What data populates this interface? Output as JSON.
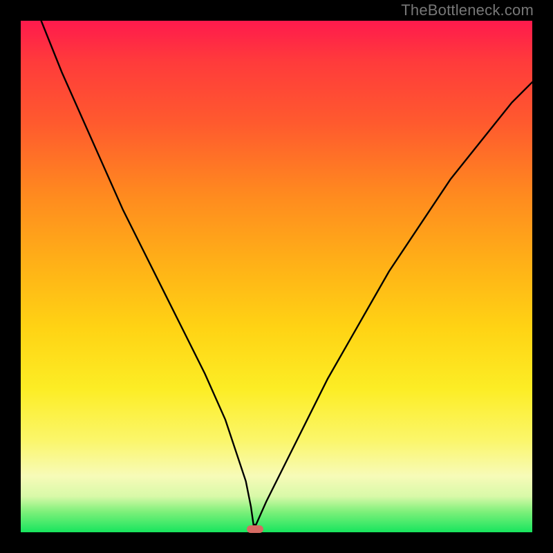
{
  "watermark": "TheBottleneck.com",
  "chart_data": {
    "type": "line",
    "title": "",
    "xlabel": "",
    "ylabel": "",
    "xlim": [
      0,
      100
    ],
    "ylim": [
      0,
      100
    ],
    "grid": false,
    "legend": false,
    "series": [
      {
        "name": "bottleneck-curve",
        "x": [
          0,
          4,
          8,
          12,
          16,
          20,
          24,
          28,
          32,
          36,
          40,
          42,
          44,
          45,
          45.5,
          46,
          48,
          52,
          56,
          60,
          64,
          68,
          72,
          76,
          80,
          84,
          88,
          92,
          96,
          100
        ],
        "y": [
          110,
          100,
          90,
          81,
          72,
          63,
          55,
          47,
          39,
          31,
          22,
          16,
          10,
          5,
          1.5,
          1.5,
          6,
          14,
          22,
          30,
          37,
          44,
          51,
          57,
          63,
          69,
          74,
          79,
          84,
          88
        ]
      }
    ],
    "minimum_marker": {
      "x": 45.8,
      "y": 0.6,
      "width_pct": 3.2,
      "height_pct": 1.4
    },
    "gradient_stops": [
      {
        "pct": 0,
        "color": "#ff1a4d"
      },
      {
        "pct": 8,
        "color": "#ff3b3b"
      },
      {
        "pct": 20,
        "color": "#ff5a2e"
      },
      {
        "pct": 34,
        "color": "#ff8a1f"
      },
      {
        "pct": 48,
        "color": "#ffb217"
      },
      {
        "pct": 60,
        "color": "#ffd314"
      },
      {
        "pct": 72,
        "color": "#fced25"
      },
      {
        "pct": 82,
        "color": "#fbf66a"
      },
      {
        "pct": 89,
        "color": "#f7fbb8"
      },
      {
        "pct": 93,
        "color": "#d8f9a8"
      },
      {
        "pct": 96,
        "color": "#7df07a"
      },
      {
        "pct": 100,
        "color": "#17e55e"
      }
    ]
  }
}
